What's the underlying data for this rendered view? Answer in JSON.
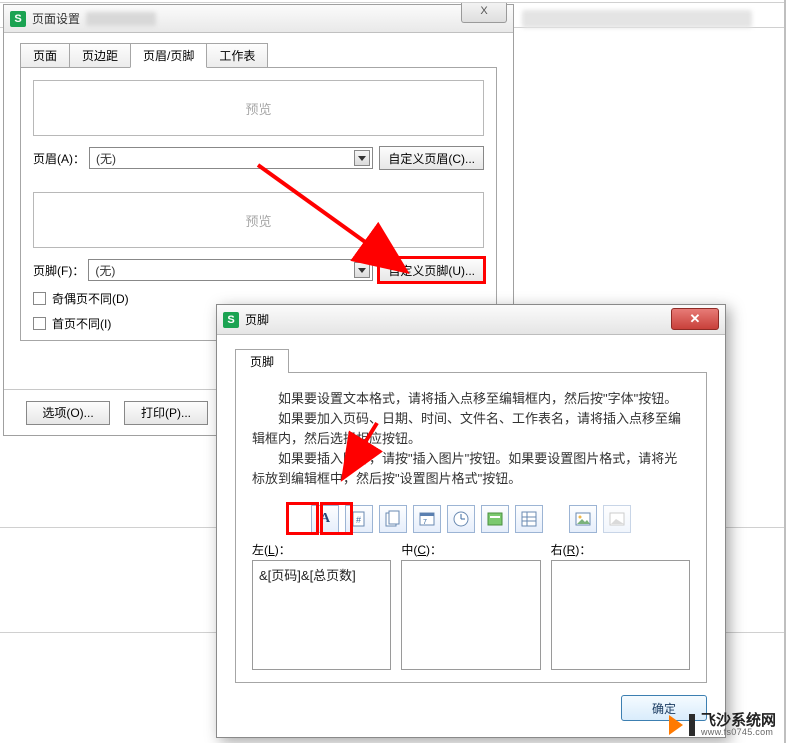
{
  "dlg1": {
    "title": "页面设置",
    "close_glyph": "X",
    "tabs": {
      "page": "页面",
      "margin": "页边距",
      "hf": "页眉/页脚",
      "sheet": "工作表"
    },
    "preview_label": "预览",
    "header": {
      "label": "页眉(A)：",
      "value": "(无)",
      "custom_btn": "自定义页眉(C)..."
    },
    "footer": {
      "label": "页脚(F)：",
      "value": "(无)",
      "custom_btn": "自定义页脚(U)..."
    },
    "odd_even_diff": "奇偶页不同(D)",
    "first_page_diff": "首页不同(I)",
    "options_btn": "选项(O)...",
    "print_btn": "打印(P)..."
  },
  "dlg2": {
    "title": "页脚",
    "tab": "页脚",
    "instr1": "如果要设置文本格式，请将插入点移至编辑框内，然后按\"字体\"按钮。",
    "instr2": "如果要加入页码、日期、时间、文件名、工作表名，请将插入点移至编辑框内，然后选择相应按钮。",
    "instr3": "如果要插入图片，请按\"插入图片\"按钮。如果要设置图片格式，请将光标放到编辑框中，然后按\"设置图片格式\"按钮。",
    "toolbar": {
      "font": "A",
      "page_no": "page-number-icon",
      "total_pages": "total-pages-icon",
      "date": "date-icon",
      "time": "time-icon",
      "path": "path-icon",
      "sheet": "sheet-icon",
      "pic": "insert-picture-icon",
      "picfmt": "format-picture-icon"
    },
    "sections": {
      "left_label_pre": "左",
      "left_label_u": "L",
      "left_value": "&[页码]&[总页数]",
      "center_label_pre": "中",
      "center_label_u": "C",
      "center_value": "",
      "right_label_pre": "右",
      "right_label_u": "R",
      "right_value": ""
    },
    "ok": "确定"
  },
  "watermark": {
    "name": "飞沙系统网",
    "url": "www.fs0745.com"
  }
}
